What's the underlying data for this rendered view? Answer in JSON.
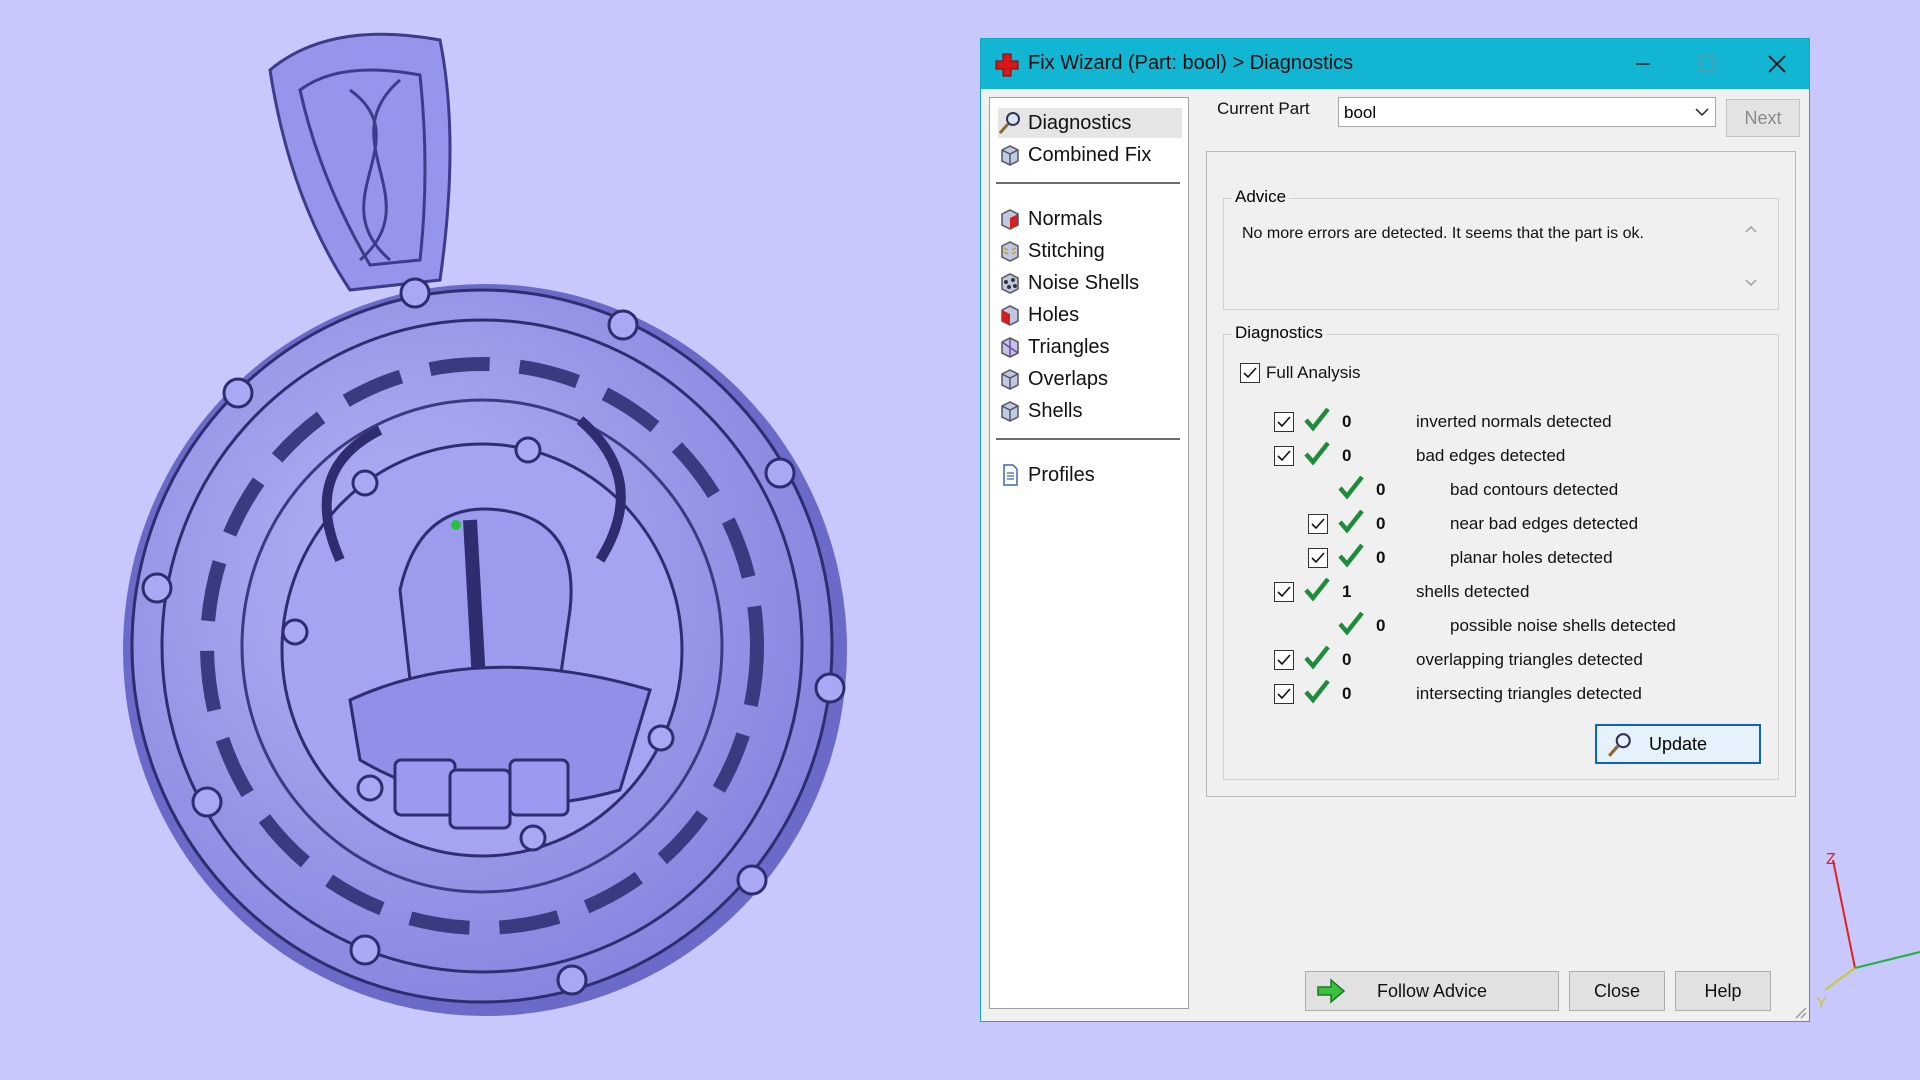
{
  "window": {
    "title": "Fix Wizard (Part: bool) > Diagnostics",
    "title_bar_color": "#12b5d2"
  },
  "nav": {
    "groups": [
      [
        "Diagnostics",
        "Combined Fix"
      ],
      [
        "Normals",
        "Stitching",
        "Noise Shells",
        "Holes",
        "Triangles",
        "Overlaps",
        "Shells"
      ],
      [
        "Profiles"
      ]
    ],
    "active": "Diagnostics",
    "icons": [
      "magnifier-icon",
      "cube-icon",
      "normals-icon",
      "stitching-icon",
      "noise-shells-icon",
      "holes-icon",
      "triangles-icon",
      "overlaps-icon",
      "shells-icon",
      "profile-document-icon"
    ]
  },
  "part": {
    "label": "Current Part",
    "value": "bool",
    "next_label": "Next"
  },
  "advice": {
    "title": "Advice",
    "text": "No more errors are detected. It seems that the part is ok."
  },
  "diagnostics": {
    "title": "Diagnostics",
    "full_analysis_label": "Full Analysis",
    "full_analysis_checked": true,
    "rows": [
      {
        "count": "0",
        "label": "inverted normals detected",
        "checkbox": true,
        "indent": 0
      },
      {
        "count": "0",
        "label": "bad edges detected",
        "checkbox": true,
        "indent": 0
      },
      {
        "count": "0",
        "label": "bad contours detected",
        "checkbox": false,
        "indent": 1
      },
      {
        "count": "0",
        "label": "near bad edges detected",
        "checkbox": true,
        "indent": 1
      },
      {
        "count": "0",
        "label": "planar holes detected",
        "checkbox": true,
        "indent": 1
      },
      {
        "count": "1",
        "label": "shells detected",
        "checkbox": true,
        "indent": 0
      },
      {
        "count": "0",
        "label": "possible noise shells detected",
        "checkbox": false,
        "indent": 1
      },
      {
        "count": "0",
        "label": "overlapping triangles detected",
        "checkbox": true,
        "indent": 0
      },
      {
        "count": "0",
        "label": "intersecting triangles detected",
        "checkbox": true,
        "indent": 0
      }
    ],
    "update_label": "Update"
  },
  "footer": {
    "follow_advice_label": "Follow Advice",
    "close_label": "Close",
    "help_label": "Help"
  },
  "axes": {
    "z_label": "Z",
    "y_label": "Y"
  },
  "colors": {
    "background": "#c8c8fd",
    "model": "#9a9af0",
    "check_green": "#1e8c3a"
  }
}
